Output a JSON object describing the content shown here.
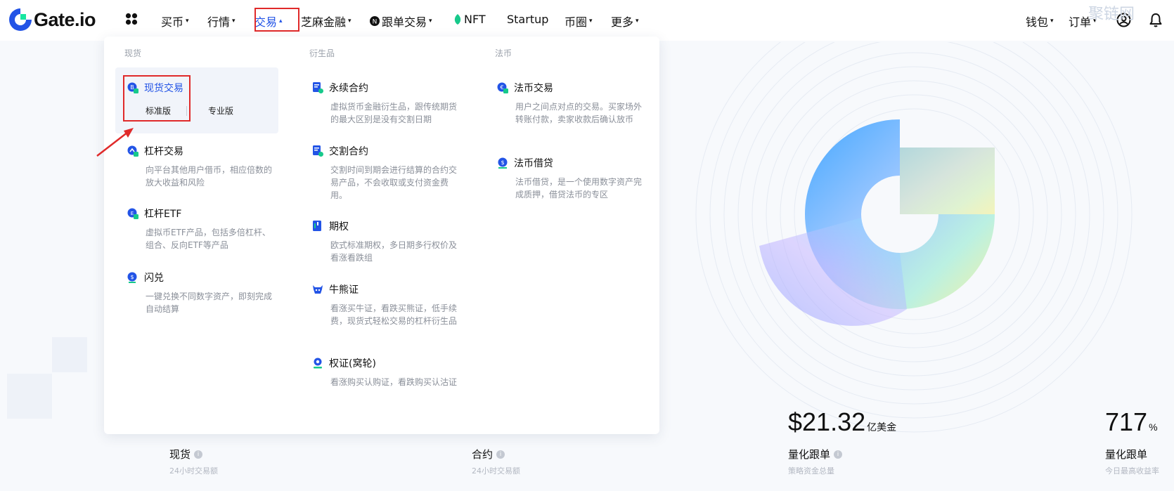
{
  "brand": {
    "logo_text": "Gate.io"
  },
  "nav": {
    "items": [
      {
        "label": "买币",
        "caret": "▾"
      },
      {
        "label": "行情",
        "caret": "▾"
      },
      {
        "label": "交易",
        "caret": "▴"
      },
      {
        "label": "芝麻金融",
        "caret": "▾"
      },
      {
        "label": "跟单交易",
        "caret": "▾"
      },
      {
        "label": "NFT",
        "caret": ""
      },
      {
        "label": "Startup",
        "caret": ""
      },
      {
        "label": "币圈",
        "caret": "▾"
      },
      {
        "label": "更多",
        "caret": "▾"
      }
    ],
    "right": {
      "wallet": "钱包",
      "wallet_caret": "▾",
      "orders": "订单",
      "orders_caret": "▾"
    },
    "active_color": "#2354e6"
  },
  "dropdown": {
    "spot": {
      "title": "现货",
      "items": [
        {
          "title": "现货交易",
          "desc": "",
          "tabs": [
            "标准版",
            "专业版"
          ]
        },
        {
          "title": "杠杆交易",
          "desc": "向平台其他用户借币，相应倍数的放大收益和风险"
        },
        {
          "title": "杠杆ETF",
          "desc": "虚拟币ETF产品，包括多倍杠杆、组合、反向ETF等产品"
        },
        {
          "title": "闪兑",
          "desc": "一键兑换不同数字资产，即刻完成自动结算"
        }
      ]
    },
    "derivatives": {
      "title": "衍生品",
      "items": [
        {
          "title": "永续合约",
          "desc": "虚拟货币金融衍生品，跟传统期货的最大区别是没有交割日期"
        },
        {
          "title": "交割合约",
          "desc": "交割时间到期会进行结算的合约交易产品，不会收取或支付资金费用。"
        },
        {
          "title": "期权",
          "desc": "欧式标准期权，多日期多行权价及看涨看跌组"
        },
        {
          "title": "牛熊证",
          "desc": "看涨买牛证，看跌买熊证，低手续费，现货式轻松交易的杠杆衍生品"
        },
        {
          "title": "权证(窝轮)",
          "desc": "看涨购买认购证，看跌购买认沽证"
        }
      ]
    },
    "fiat": {
      "title": "法币",
      "items": [
        {
          "title": "法币交易",
          "desc": "用户之间点对点的交易。买家场外转账付款，卖家收款后确认放币"
        },
        {
          "title": "法币借贷",
          "desc": "法币借贷，是一个使用数字资产完成质押，借贷法币的专区"
        }
      ]
    }
  },
  "stats": [
    {
      "label": "现货",
      "sub": "24小时交易额",
      "value": "",
      "unit": ""
    },
    {
      "label": "合约",
      "sub": "24小时交易额",
      "value": "",
      "unit": ""
    },
    {
      "label": "量化跟单",
      "sub": "策略资金总量",
      "value": "$21.32",
      "unit": "亿美金"
    },
    {
      "label": "量化跟单",
      "sub": "今日最高收益率",
      "value": "717",
      "unit": "%"
    }
  ],
  "watermark": "聚链网"
}
